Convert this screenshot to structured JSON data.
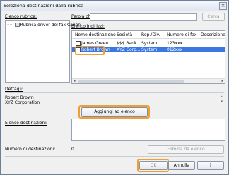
{
  "window": {
    "title": "Seleziona destinazioni dalla rubrica",
    "close_glyph": "×"
  },
  "address_book": {
    "label": "Elenco rubrica:",
    "tree": [
      {
        "label": "Rubrica driver del fax Canon"
      }
    ]
  },
  "search": {
    "label": "Parola chiave:",
    "value": "",
    "button_label": "Cerca"
  },
  "address_list": {
    "label": "Elenco indirizzi:",
    "columns": [
      "Nome destinazione",
      "Società",
      "Rep./Div.",
      "Numero di fax",
      "Descrizione"
    ],
    "rows": [
      {
        "name": "James Green",
        "company": "$$$ Bank",
        "department": "System",
        "fax": "123xxx",
        "description": "",
        "selected": false
      },
      {
        "name": "Robert Brown",
        "company": "XYZ Corp...",
        "department": "System",
        "fax": "012xxx",
        "description": "",
        "selected": true
      }
    ],
    "scroll_left": "◂",
    "scroll_right": "▸"
  },
  "details": {
    "label": "Dettagli:",
    "lines": [
      "Robert Brown",
      "XYZ Corporation"
    ],
    "scroll_up": "▴",
    "scroll_down": "▾"
  },
  "add_button_label": "Aggiungi ad elenco",
  "destinations": {
    "label": "Elenco destinazioni:"
  },
  "count": {
    "label": "Numero di destinazioni:",
    "value": "0"
  },
  "remove_button_label": "Elimina da elenco",
  "footer": {
    "ok_label": "OK",
    "cancel_label": "Annulla",
    "help_label": "?"
  },
  "colors": {
    "highlight_ring": "#f0a030",
    "selection": "#3a78e0"
  }
}
